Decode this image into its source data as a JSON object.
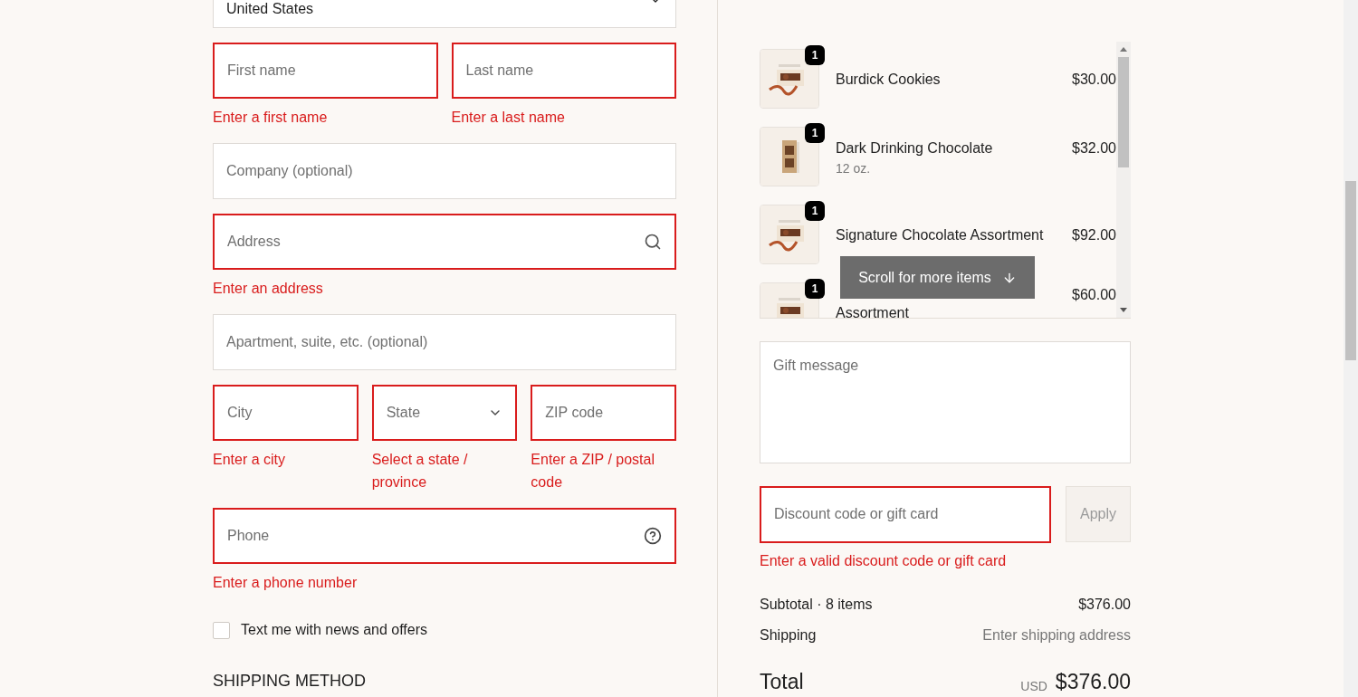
{
  "form": {
    "country": {
      "value": "United States"
    },
    "rows": [
      {
        "fields": [
          {
            "kind": "text",
            "placeholder": "First name",
            "invalid": true,
            "error": "Enter a first name"
          },
          {
            "kind": "text",
            "placeholder": "Last name",
            "invalid": true,
            "error": "Enter a last name"
          }
        ]
      },
      {
        "fields": [
          {
            "kind": "text",
            "placeholder": "Company (optional)",
            "invalid": false
          }
        ]
      },
      {
        "fields": [
          {
            "kind": "search",
            "placeholder": "Address",
            "invalid": true,
            "error": "Enter an address"
          }
        ]
      },
      {
        "fields": [
          {
            "kind": "text",
            "placeholder": "Apartment, suite, etc. (optional)",
            "invalid": false
          }
        ]
      },
      {
        "fields": [
          {
            "kind": "text",
            "placeholder": "City",
            "invalid": true,
            "error": "Enter a city"
          },
          {
            "kind": "select",
            "placeholder": "State",
            "invalid": true,
            "error": "Select a state / province"
          },
          {
            "kind": "text",
            "placeholder": "ZIP code",
            "invalid": true,
            "error": "Enter a ZIP / postal code"
          }
        ]
      },
      {
        "fields": [
          {
            "kind": "help",
            "placeholder": "Phone",
            "invalid": true,
            "error": "Enter a phone number"
          }
        ]
      }
    ],
    "sms_opt_in": {
      "label": "Text me with news and offers",
      "checked": false
    },
    "shipping_heading": "SHIPPING METHOD"
  },
  "cart": {
    "items": [
      {
        "kind": "full",
        "name": "Burdick Cookies",
        "price": "$30.00",
        "quantity": "1"
      },
      {
        "kind": "full",
        "name": "Dark Drinking Chocolate",
        "variant": "12 oz.",
        "price": "$32.00",
        "quantity": "1"
      },
      {
        "kind": "full",
        "name": "Signature Chocolate Assortment",
        "price": "$92.00",
        "quantity": "1"
      },
      {
        "kind": "partial",
        "name": "Assortment",
        "price": "$60.00",
        "quantity": "1"
      }
    ],
    "scroll_hint": "Scroll for more items",
    "gift_message": {
      "placeholder": "Gift message"
    },
    "discount": {
      "placeholder": "Discount code or gift card",
      "invalid": true,
      "error": "Enter a valid discount code or gift card",
      "button": "Apply",
      "button_disabled": true
    },
    "subtotal": {
      "label": "Subtotal · 8 items",
      "value": "$376.00"
    },
    "shipping": {
      "label": "Shipping",
      "value": "Enter shipping address"
    },
    "total": {
      "label": "Total",
      "currency": "USD",
      "value": "$376.00"
    }
  }
}
